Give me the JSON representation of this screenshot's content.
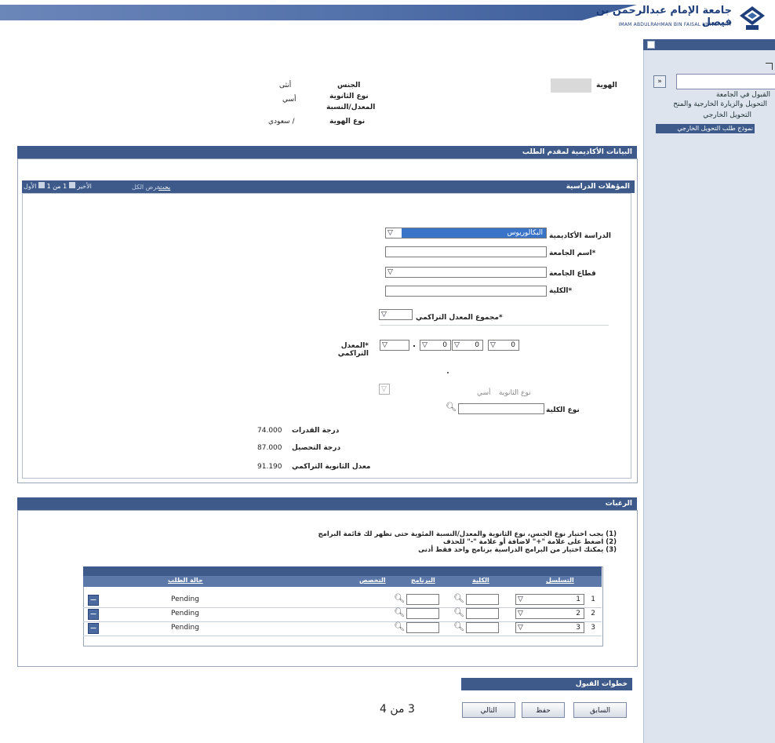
{
  "header": {
    "university_ar": "جامعة الإمام عبدالرحمن بن فيصل",
    "university_en": "IMAM ABDULRAHMAN BIN FAISAL UNIVERSITY"
  },
  "sidebar": {
    "search_button": "»",
    "items": [
      "القبول في الجامعة",
      "التحويل والزيارة الخارجية والمنح",
      "التحويل الخارجي",
      "نموذج طلب التحويل الخارجي"
    ]
  },
  "identity": {
    "id_label": "الهوية",
    "gender_label": "الجنس",
    "gender_value": "أنثى",
    "school_type_label": "نوع الثانوية",
    "school_type_value": "أسي",
    "percentage_label": "المعدل/النسبة",
    "id_type_label": "نوع الهوية",
    "id_type_value": "/ سعودي"
  },
  "academic": {
    "title": "البيانات الأكاديمية لمقدم الطلب",
    "sub_title": "المؤهلات الدراسية",
    "nav": {
      "find": "بحث",
      "view_all": "عرض الكل",
      "first": "الأول",
      "page": "1 من 1",
      "last": "الأخير"
    },
    "fields": {
      "degree_label": "الدراسة الأكاديمية",
      "degree_value": "البكالوريوس",
      "univ_name_label": "*اسم الجامعة",
      "univ_sector_label": "قطاع الجامعة",
      "college_label": "*الكلية",
      "gpa_total_label": "*مجموع المعدل التراكمي",
      "gpa_label": "*المعدل التراكمي",
      "gpa_digit": "0",
      "school_type_label": "نوع الثانوية",
      "school_type_value": "أسي",
      "college_type_label": "نوع الكلية",
      "aptitude_label": "درجة القدرات",
      "aptitude_value": "74.000",
      "achievement_label": "درجة التحصيل",
      "achievement_value": "87.000",
      "hs_gpa_label": "معدل الثانوية التراكمي",
      "hs_gpa_value": "91.190"
    }
  },
  "preferences": {
    "title": "الرغبات",
    "notes": [
      "(1) يجب اختيار نوع الجنس، نوع الثانوية والمعدل/النسبة المئوية حتى تظهر لك قائمة البرامج",
      "(2) اضغط على علامة \"+\" لاضافة أو علامة \"-\" للحذف",
      "(3) يمكنك اختيار من البرامج الدراسية برنامج واحد فقط أدنى"
    ],
    "columns": [
      "التسلسل",
      "الكلية",
      "البرنامج",
      "التخصص",
      "حالة الطلب"
    ],
    "rows": [
      {
        "index": "1",
        "seq": "1",
        "status": "Pending"
      },
      {
        "index": "2",
        "seq": "2",
        "status": "Pending"
      },
      {
        "index": "3",
        "seq": "3",
        "status": "Pending"
      }
    ]
  },
  "steps": {
    "title": "خطوات القبول",
    "previous": "السابق",
    "save": "حفظ",
    "next": "التالي",
    "page_indicator": "3 من 4"
  }
}
